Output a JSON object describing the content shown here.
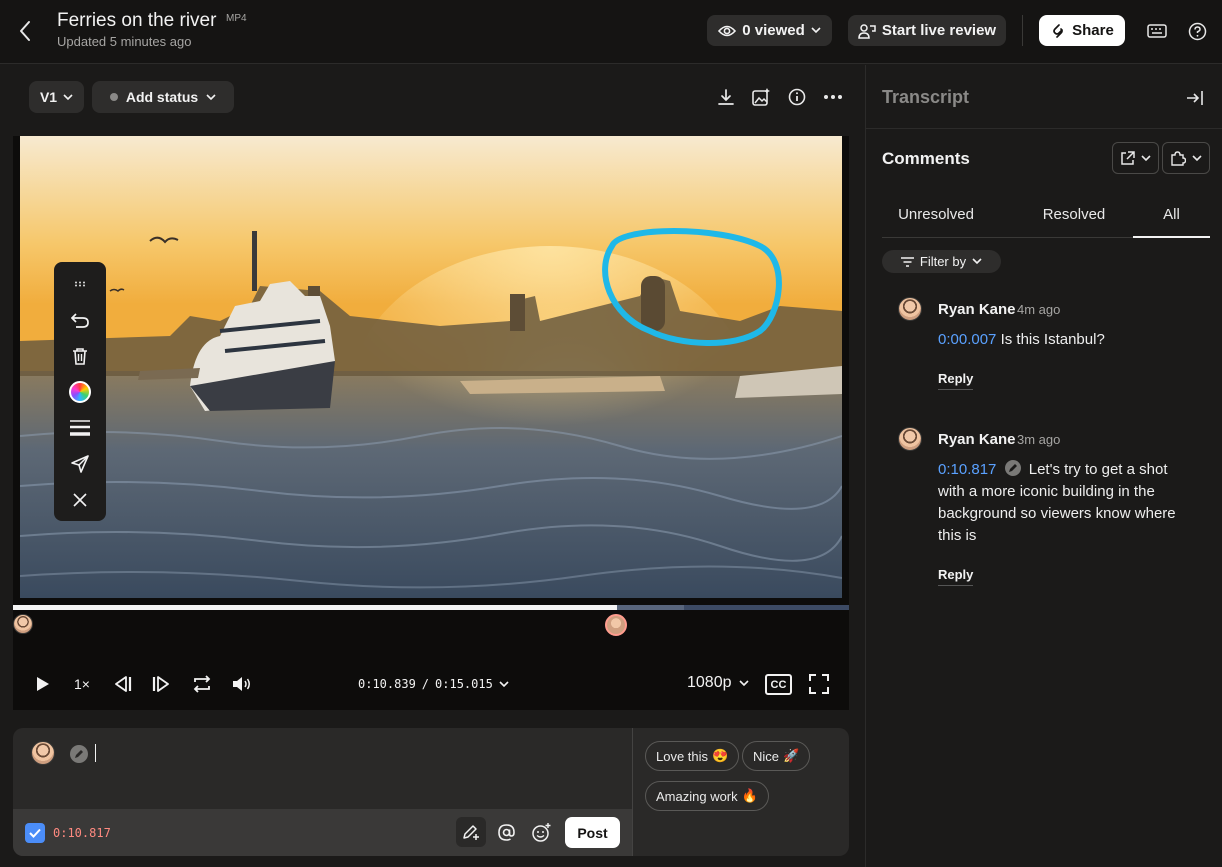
{
  "header": {
    "title": "Ferries on the river",
    "file_type": "MP4",
    "subtitle": "Updated 5 minutes ago",
    "viewed_label": "0 viewed",
    "live_review_label": "Start live review",
    "share_label": "Share"
  },
  "toolbar": {
    "version_label": "V1",
    "status_label": "Add status"
  },
  "player": {
    "current_time": "0:10.839",
    "total_time": "0:15.015",
    "speed_label": "1×",
    "quality_label": "1080p",
    "progress": 0.723,
    "buffered": 0.803,
    "cc_label": "CC"
  },
  "composer": {
    "timestamp": "0:10.817",
    "post_label": "Post",
    "quick_reactions": [
      {
        "label": "Love this",
        "emoji": "😍"
      },
      {
        "label": "Nice",
        "emoji": "🚀"
      },
      {
        "label": "Amazing work",
        "emoji": "🔥"
      }
    ]
  },
  "panel": {
    "transcript_label": "Transcript",
    "comments_label": "Comments",
    "tabs": [
      "Unresolved",
      "Resolved",
      "All"
    ],
    "active_tab": "All",
    "filter_label": "Filter by",
    "comments": [
      {
        "author": "Ryan Kane",
        "time": "4m ago",
        "timestamp": "0:00.007",
        "text": "Is this Istanbul?",
        "reply_label": "Reply",
        "has_annotation": false
      },
      {
        "author": "Ryan Kane",
        "time": "3m ago",
        "timestamp": "0:10.817",
        "text": "Let's try to get a shot with a more iconic building in the background so viewers know where this is",
        "reply_label": "Reply",
        "has_annotation": true
      }
    ]
  },
  "colors": {
    "accent_blue": "#5aa1ff",
    "annotation_stroke": "#1fb8e8",
    "timestamp_red": "#ff8a80",
    "checkbox_blue": "#4b8df8"
  }
}
